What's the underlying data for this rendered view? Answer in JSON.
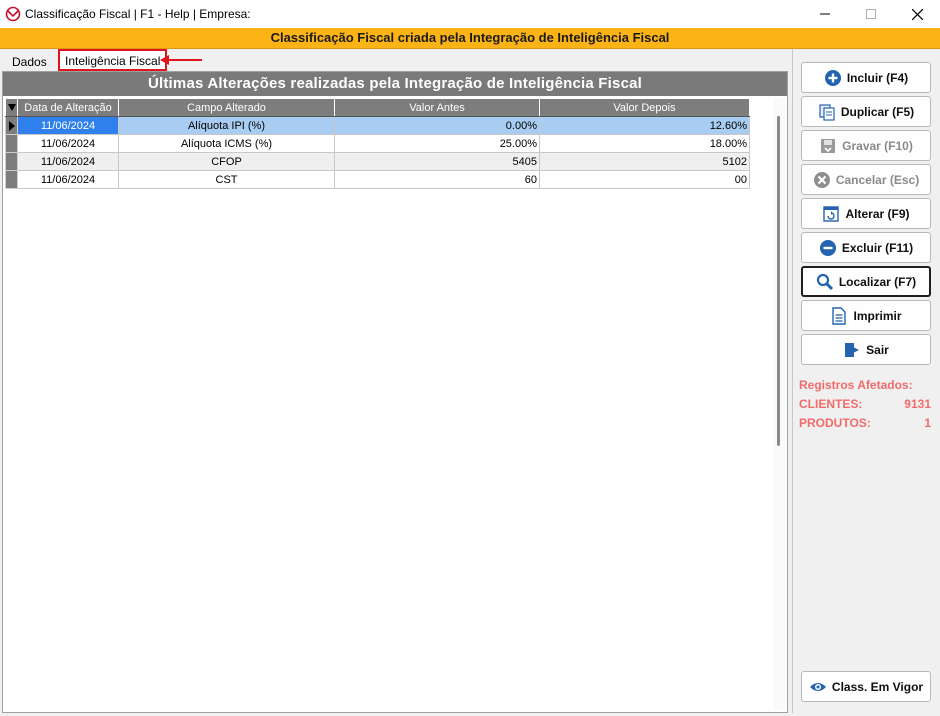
{
  "window": {
    "title": "Classificação Fiscal | F1 - Help | Empresa:",
    "banner": "Classificação Fiscal criada pela Integração de Inteligência Fiscal"
  },
  "tabs": [
    {
      "label": "Dados"
    },
    {
      "label": "Inteligência Fiscal"
    }
  ],
  "grid": {
    "title": "Últimas Alterações realizadas pela Integração de Inteligência Fiscal",
    "columns": [
      "Data de Alteração",
      "Campo Alterado",
      "Valor Antes",
      "Valor Depois"
    ],
    "rows": [
      {
        "data": "11/06/2024",
        "campo": "Alíquota IPI (%)",
        "antes": "0.00%",
        "depois": "12.60%"
      },
      {
        "data": "11/06/2024",
        "campo": "Alíquota ICMS (%)",
        "antes": "25.00%",
        "depois": "18.00%"
      },
      {
        "data": "11/06/2024",
        "campo": "CFOP",
        "antes": "5405",
        "depois": "5102"
      },
      {
        "data": "11/06/2024",
        "campo": "CST",
        "antes": "60",
        "depois": "00"
      }
    ]
  },
  "sidebar": {
    "buttons": [
      {
        "label": "Incluir (F4)"
      },
      {
        "label": "Duplicar (F5)"
      },
      {
        "label": "Gravar (F10)"
      },
      {
        "label": "Cancelar (Esc)"
      },
      {
        "label": "Alterar (F9)"
      },
      {
        "label": "Excluir (F11)"
      },
      {
        "label": "Localizar (F7)"
      },
      {
        "label": "Imprimir"
      },
      {
        "label": "Sair"
      }
    ],
    "stats": {
      "heading": "Registros Afetados:",
      "clientes_label": "CLIENTES:",
      "clientes_value": "9131",
      "produtos_label": "PRODUTOS:",
      "produtos_value": "1"
    },
    "bottom_button": {
      "label": "Class. Em Vigor"
    }
  },
  "colors": {
    "banner": "#fbb316",
    "highlight": "#e0141c",
    "stats": "#f26b6b",
    "selection": "#2f80ed"
  }
}
